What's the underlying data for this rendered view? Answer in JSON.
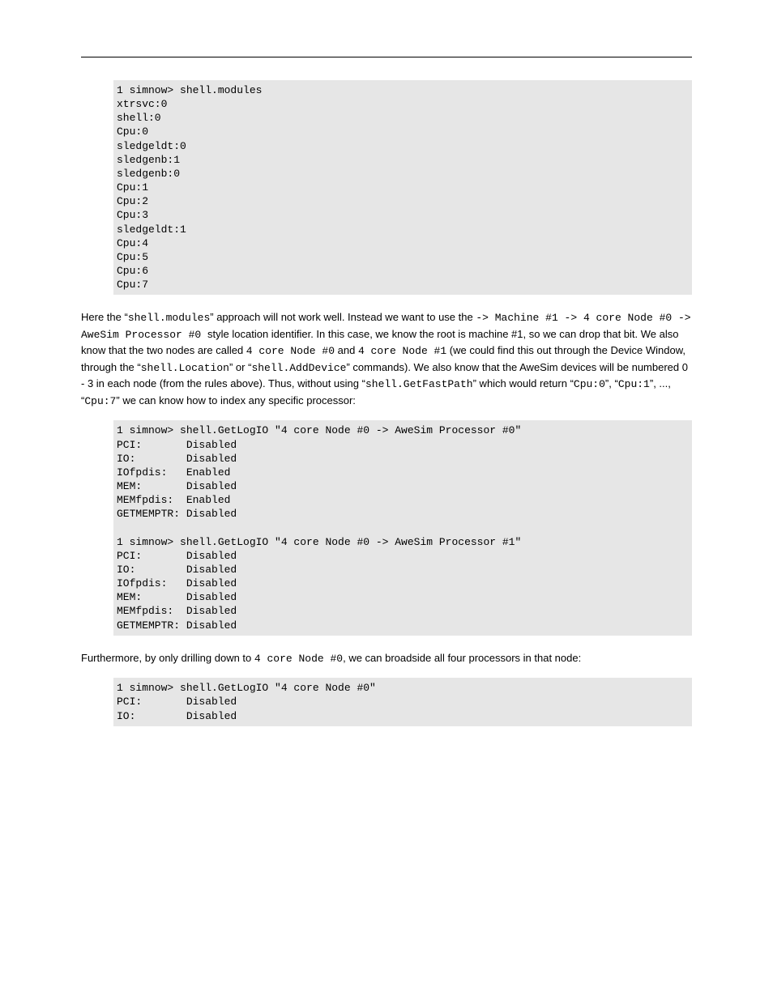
{
  "code1": "1 simnow> shell.modules\nxtrsvc:0\nshell:0\nCpu:0\nsledgeldt:0\nsledgenb:1\nsledgenb:0\nCpu:1\nCpu:2\nCpu:3\nsledgeldt:1\nCpu:4\nCpu:5\nCpu:6\nCpu:7",
  "para1a": "Here the ",
  "para1q1": "“",
  "para1mono1": "shell.modules",
  "para1q2": "”",
  "para1b": " approach will not work well. Instead we want to use the ",
  "para1mono2": "-> Machine #1 -> 4 core Node #0 -> AweSim Processor #0 ",
  "para1c": "style location identifier. In this case, we know the root is machine #1, so we can drop that bit. We also know that the two nodes are called ",
  "para1mono3": "4 core Node #0",
  "para1d": " and ",
  "para1mono4": "4 core Node #1",
  "para1e": " (we could find this out through the Device Window, through the ",
  "para1q3": "“",
  "para1mono5": "shell.Location",
  "para1q4": "”",
  "para1f": " or ",
  "para1q5": "“",
  "para1mono6": "shell.AddDevice",
  "para1q6": "”",
  "para1g": " commands). We also know that the AweSim devices will be numbered 0 - 3 in each node (from the rules above). Thus, without using ",
  "para1q7": "“",
  "para1mono7": "shell.GetFastPath",
  "para1q8": "”",
  "para1h": " which would return ",
  "para1q9": "“",
  "para1mono8": "Cpu:0",
  "para1q10": "”",
  "para1i": ", ",
  "para1q11": "“",
  "para1mono9": "Cpu:1",
  "para1q12": "”",
  "para1j": ", ..., ",
  "para1q13": "“",
  "para1mono10": "Cpu:7",
  "para1q14": "”",
  "para1k": " we can know how to index any specific processor:",
  "code2": "1 simnow> shell.GetLogIO \"4 core Node #0 -> AweSim Processor #0\"\nPCI:       Disabled\nIO:        Disabled\nIOfpdis:   Enabled\nMEM:       Disabled\nMEMfpdis:  Enabled\nGETMEMPTR: Disabled\n\n1 simnow> shell.GetLogIO \"4 core Node #0 -> AweSim Processor #1\"\nPCI:       Disabled\nIO:        Disabled\nIOfpdis:   Disabled\nMEM:       Disabled\nMEMfpdis:  Disabled\nGETMEMPTR: Disabled",
  "para2a": "Furthermore, by only drilling down to ",
  "para2mono1": "4 core Node #0",
  "para2b": ", we can broadside all four processors in that node:",
  "code3": "1 simnow> shell.GetLogIO \"4 core Node #0\"\nPCI:       Disabled\nIO:        Disabled"
}
